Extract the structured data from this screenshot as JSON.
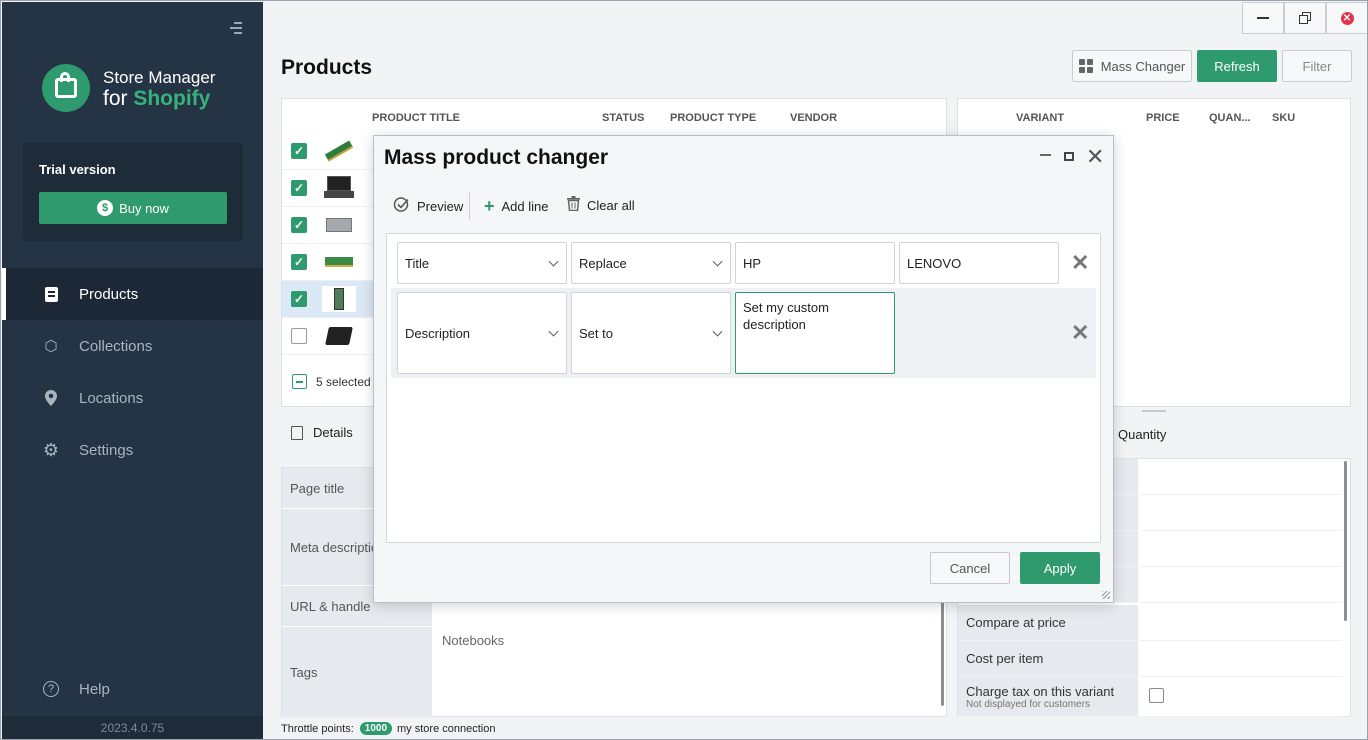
{
  "sidebar": {
    "logo": {
      "line1": "Store Manager",
      "line2_prefix": "for ",
      "line2_brand": "Shopify"
    },
    "trial_label": "Trial version",
    "buy_label": "Buy now",
    "nav": [
      {
        "label": "Products",
        "icon": "document-icon",
        "active": true
      },
      {
        "label": "Collections",
        "icon": "box-icon"
      },
      {
        "label": "Locations",
        "icon": "pin-icon"
      },
      {
        "label": "Settings",
        "icon": "gear-icon"
      }
    ],
    "help_label": "Help",
    "version": "2023.4.0.75"
  },
  "header": {
    "title": "Products",
    "mass_changer_label": "Mass Changer",
    "refresh_label": "Refresh",
    "filter_label": "Filter"
  },
  "products_table": {
    "columns": [
      "PRODUCT TITLE",
      "STATUS",
      "PRODUCT TYPE",
      "VENDOR"
    ],
    "rows": [
      {
        "checked": true,
        "thumb": "ram-stick"
      },
      {
        "checked": true,
        "thumb": "laptop"
      },
      {
        "checked": true,
        "thumb": "power-supply"
      },
      {
        "checked": true,
        "thumb": "ram-module"
      },
      {
        "checked": true,
        "thumb": "circuit-board",
        "selected": true
      },
      {
        "checked": false,
        "thumb": "black-box"
      }
    ],
    "selected_label": "5 selected"
  },
  "variants_table": {
    "columns": [
      "VARIANT",
      "PRICE",
      "QUAN...",
      "SKU"
    ]
  },
  "details": {
    "tab_label": "Details",
    "fields": [
      {
        "label": "Page title",
        "value": ""
      },
      {
        "label": "Meta description",
        "value": ""
      },
      {
        "label": "URL & handle",
        "value": ""
      },
      {
        "label": "Tags",
        "value": "Notebooks"
      }
    ]
  },
  "variant_info": {
    "tab_label": "Quantity",
    "fields": [
      {
        "label": "Compare at price"
      },
      {
        "label": "Cost per item"
      },
      {
        "label": "Charge tax on this variant",
        "sub": "Not displayed for customers"
      }
    ]
  },
  "status_bar": {
    "throttle_label": "Throttle points:",
    "throttle_value": "1000",
    "connection": "my store connection"
  },
  "modal": {
    "title": "Mass product changer",
    "toolbar": {
      "preview": "Preview",
      "add_line": "Add line",
      "clear_all": "Clear all"
    },
    "lines": [
      {
        "field": "Title",
        "operation": "Replace",
        "value1": "HP",
        "value2": "LENOVO"
      },
      {
        "field": "Description",
        "operation": "Set to",
        "value1": "Set my custom description"
      }
    ],
    "cancel_label": "Cancel",
    "apply_label": "Apply"
  },
  "colors": {
    "accent": "#2e9a6e",
    "sidebar": "#253444",
    "close": "#e1344a"
  }
}
